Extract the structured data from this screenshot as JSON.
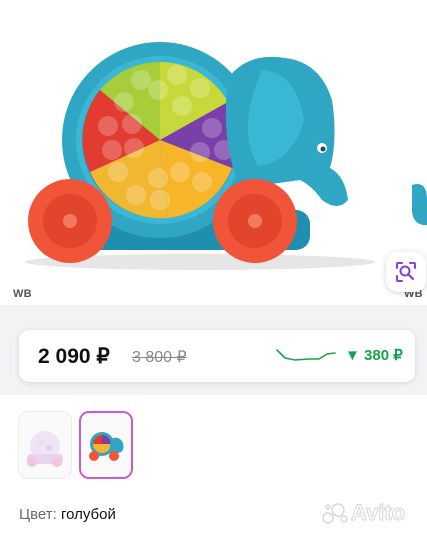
{
  "hero": {
    "watermark_left": "WB",
    "watermark_right": "WB",
    "visual_search_icon": "image-search-icon"
  },
  "price": {
    "current": "2 090 ₽",
    "old": "3 800 ₽",
    "drop": "▼ 380 ₽",
    "drop_color": "#17a34a",
    "trend_icon": "price-trend-line-icon"
  },
  "thumbnails": [
    {
      "name": "thumb-variant-pink",
      "selected": false
    },
    {
      "name": "thumb-variant-blue",
      "selected": true
    }
  ],
  "variant": {
    "label": "Цвет:",
    "value": "голубой"
  },
  "brand_watermark": {
    "text": "Avito"
  },
  "colors": {
    "accent_selected": "#c65bd6",
    "toy_teal": "#2fa6c4",
    "toy_orange": "#f0553a"
  }
}
